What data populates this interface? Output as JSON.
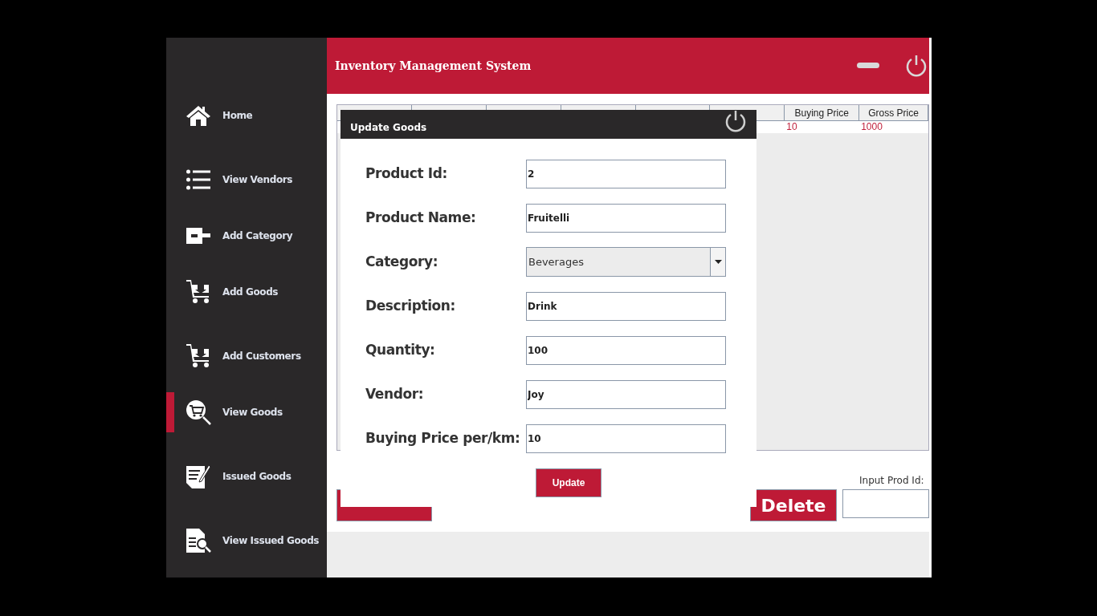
{
  "window": {
    "title": "Inventory Management System"
  },
  "sidebar": {
    "items": [
      {
        "label": "Home",
        "kind": "home",
        "selected": false
      },
      {
        "label": "View Vendors",
        "kind": "list",
        "selected": false
      },
      {
        "label": "Add Category",
        "kind": "category",
        "selected": false
      },
      {
        "label": "Add Goods",
        "kind": "cart",
        "selected": false
      },
      {
        "label": "Add Customers",
        "kind": "cart",
        "selected": false
      },
      {
        "label": "View Goods",
        "kind": "cartsearch",
        "selected": true
      },
      {
        "label": "Issued Goods",
        "kind": "docedit",
        "selected": false
      },
      {
        "label": "View Issued Goods",
        "kind": "docsearch",
        "selected": false
      }
    ]
  },
  "table": {
    "columns": [
      {
        "label": "Buying Price"
      },
      {
        "label": "Gross Price"
      }
    ],
    "rows": [
      [
        "10",
        "1000"
      ]
    ]
  },
  "dialog": {
    "title": "Update Goods",
    "fields": [
      {
        "label": "Product Id:",
        "kind": "text",
        "value": "2"
      },
      {
        "label": "Product Name:",
        "kind": "text",
        "value": "Fruitelli"
      },
      {
        "label": "Category:",
        "kind": "select",
        "value": "Beverages"
      },
      {
        "label": "Description:",
        "kind": "text",
        "value": "Drink"
      },
      {
        "label": "Quantity:",
        "kind": "text",
        "value": "100"
      },
      {
        "label": "Vendor:",
        "kind": "text",
        "value": "Joy"
      },
      {
        "label": "Buying Price per/km:",
        "kind": "text",
        "value": "10"
      }
    ],
    "button": "Update"
  },
  "delete_button": "Delete",
  "prod_id": {
    "label": "Input Prod Id:"
  }
}
